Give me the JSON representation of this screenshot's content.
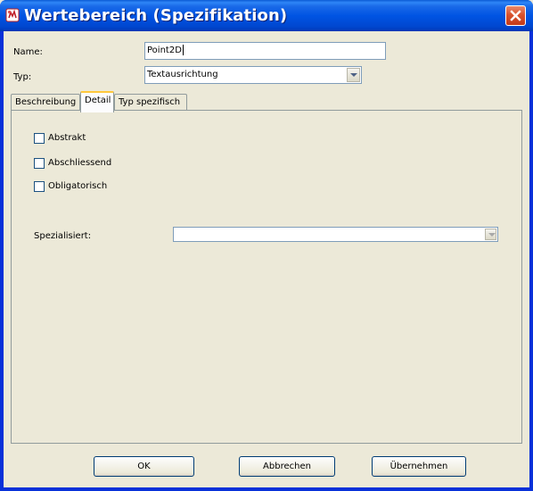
{
  "window": {
    "title": "Wertebereich (Spezifikation)",
    "close_label": "close"
  },
  "form": {
    "name_label": "Name:",
    "name_value": "Point2D",
    "typ_label": "Typ:",
    "typ_value": "Textausrichtung"
  },
  "tabs": [
    {
      "label": "Beschreibung",
      "active": false
    },
    {
      "label": "Detail",
      "active": true
    },
    {
      "label": "Typ spezifisch",
      "active": false
    }
  ],
  "detail": {
    "checkboxes": [
      {
        "label": "Abstrakt",
        "checked": false
      },
      {
        "label": "Abschliessend",
        "checked": false
      },
      {
        "label": "Obligatorisch",
        "checked": false
      }
    ],
    "spezialisiert_label": "Spezialisiert:",
    "spezialisiert_value": ""
  },
  "buttons": {
    "ok": "OK",
    "cancel": "Abbrechen",
    "apply": "Übernehmen"
  },
  "colors": {
    "titlebar": "#0054e3",
    "window_bg": "#ece9d8",
    "close_button": "#d9522e"
  }
}
